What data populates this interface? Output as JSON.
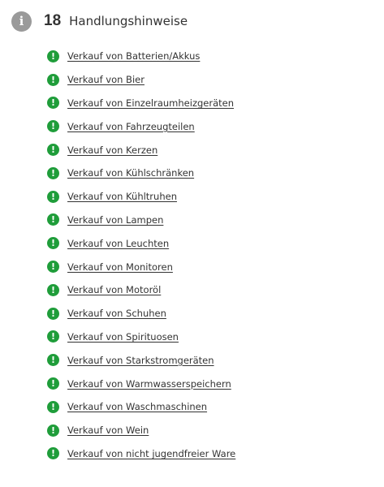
{
  "header": {
    "info_icon": "info-icon",
    "count": "18",
    "title": "Handlungshinweise"
  },
  "colors": {
    "status_ok": "#1f9d3a",
    "info_icon_bg": "#9a9a9a",
    "text": "#333333"
  },
  "items": [
    {
      "label": "Verkauf von Batterien/Akkus",
      "icon": "exclamation-icon"
    },
    {
      "label": "Verkauf von Bier",
      "icon": "exclamation-icon"
    },
    {
      "label": "Verkauf von Einzelraumheizgeräten",
      "icon": "exclamation-icon"
    },
    {
      "label": "Verkauf von Fahrzeugteilen",
      "icon": "exclamation-icon"
    },
    {
      "label": "Verkauf von Kerzen",
      "icon": "exclamation-icon"
    },
    {
      "label": "Verkauf von Kühlschränken",
      "icon": "exclamation-icon"
    },
    {
      "label": "Verkauf von Kühltruhen",
      "icon": "exclamation-icon"
    },
    {
      "label": "Verkauf von Lampen",
      "icon": "exclamation-icon"
    },
    {
      "label": "Verkauf von Leuchten",
      "icon": "exclamation-icon"
    },
    {
      "label": "Verkauf von Monitoren",
      "icon": "exclamation-icon"
    },
    {
      "label": "Verkauf von Motoröl",
      "icon": "exclamation-icon"
    },
    {
      "label": "Verkauf von Schuhen",
      "icon": "exclamation-icon"
    },
    {
      "label": "Verkauf von Spirituosen",
      "icon": "exclamation-icon"
    },
    {
      "label": "Verkauf von Starkstromgeräten",
      "icon": "exclamation-icon"
    },
    {
      "label": "Verkauf von Warmwasserspeichern",
      "icon": "exclamation-icon"
    },
    {
      "label": "Verkauf von Waschmaschinen",
      "icon": "exclamation-icon"
    },
    {
      "label": "Verkauf von Wein",
      "icon": "exclamation-icon"
    },
    {
      "label": "Verkauf von nicht jugendfreier Ware",
      "icon": "exclamation-icon"
    }
  ]
}
